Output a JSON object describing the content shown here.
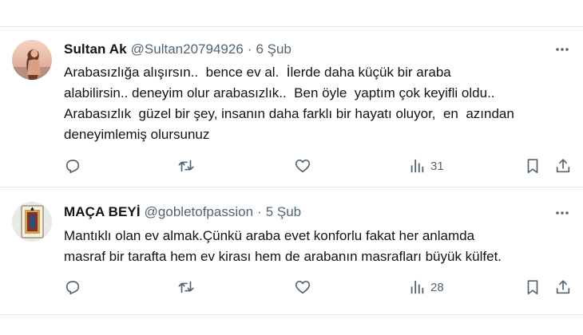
{
  "tweets": [
    {
      "name": "Sultan Ak",
      "handle": "@Sultan20794926",
      "separator": "·",
      "time": "6 Şub",
      "lines": [
        "Arabasızlığa alışırsın..  bence ev al.  İlerde daha küçük bir araba",
        "alabilirsin.. deneyim olur arabasızlık..  Ben öyle  yaptım çok keyifli oldu..",
        "Arabasızlık  güzel bir şey, insanın daha farklı bir hayatı oluyor,  en  azından",
        "deneyimlemiş olursunuz"
      ],
      "views": "31"
    },
    {
      "name": "MAÇA BEYİ",
      "handle": "@gobletofpassion",
      "separator": "·",
      "time": "5 Şub",
      "lines": [
        "Mantıklı olan ev almak.Çünkü araba evet konforlu fakat her anlamda",
        "masraf bir tarafta hem ev kirası hem de arabanın masrafları büyük külfet."
      ],
      "views": "28"
    }
  ],
  "icons": {
    "more": "more-horizontal-icon",
    "reply": "reply-icon",
    "retweet": "retweet-icon",
    "like": "heart-icon",
    "views": "views-icon",
    "bookmark": "bookmark-icon",
    "share": "share-icon"
  },
  "colors": {
    "text": "#0f1419",
    "muted": "#536471",
    "divider": "#e6e9eb"
  }
}
